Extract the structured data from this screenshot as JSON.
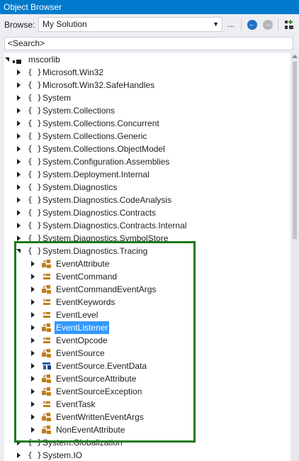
{
  "window": {
    "title": "Object Browser"
  },
  "toolbar": {
    "browse_label": "Browse:",
    "browse_value": "My Solution",
    "more_label": "..."
  },
  "search": {
    "placeholder": "<Search>"
  },
  "tree": {
    "root": "mscorlib",
    "namespaces_before": [
      "Microsoft.Win32",
      "Microsoft.Win32.SafeHandles",
      "System",
      "System.Collections",
      "System.Collections.Concurrent",
      "System.Collections.Generic",
      "System.Collections.ObjectModel",
      "System.Configuration.Assemblies",
      "System.Deployment.Internal",
      "System.Diagnostics",
      "System.Diagnostics.CodeAnalysis",
      "System.Diagnostics.Contracts",
      "System.Diagnostics.Contracts.Internal",
      "System.Diagnostics.SymbolStore"
    ],
    "expanded_namespace": "System.Diagnostics.Tracing",
    "types": [
      {
        "label": "EventAttribute",
        "kind": "class"
      },
      {
        "label": "EventCommand",
        "kind": "enum"
      },
      {
        "label": "EventCommandEventArgs",
        "kind": "class"
      },
      {
        "label": "EventKeywords",
        "kind": "enum"
      },
      {
        "label": "EventLevel",
        "kind": "enum"
      },
      {
        "label": "EventListener",
        "kind": "class",
        "selected": true
      },
      {
        "label": "EventOpcode",
        "kind": "enum"
      },
      {
        "label": "EventSource",
        "kind": "class"
      },
      {
        "label": "EventSource.EventData",
        "kind": "struct"
      },
      {
        "label": "EventSourceAttribute",
        "kind": "class"
      },
      {
        "label": "EventSourceException",
        "kind": "class"
      },
      {
        "label": "EventTask",
        "kind": "enum"
      },
      {
        "label": "EventWrittenEventArgs",
        "kind": "class"
      },
      {
        "label": "NonEventAttribute",
        "kind": "class"
      }
    ],
    "namespaces_after": [
      "System.Globalization",
      "System.IO"
    ]
  },
  "colors": {
    "title_bar": "#007acc",
    "selection": "#3399ff",
    "highlight_border": "#1b7a1b",
    "class_icon": "#c27d1a",
    "struct_icon": "#2a5db0"
  },
  "icons": [
    "back-icon",
    "forward-icon",
    "add-reference-icon"
  ]
}
